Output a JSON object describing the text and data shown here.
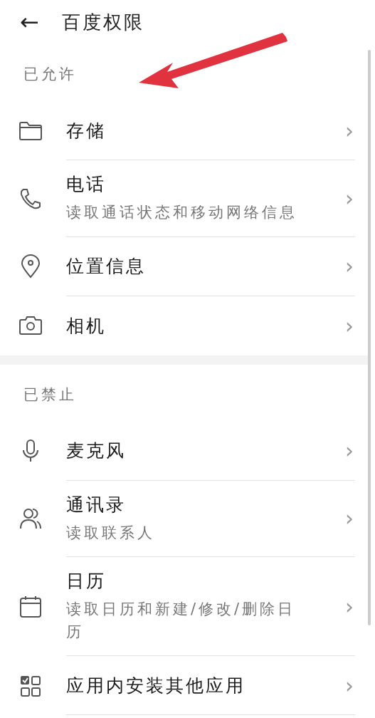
{
  "header": {
    "back": "←",
    "title": "百度权限"
  },
  "sections": [
    {
      "label": "已允许",
      "items": [
        {
          "title": "存储",
          "chevron": "›"
        },
        {
          "title": "电话",
          "subtitle": "读取通话状态和移动网络信息",
          "chevron": "›"
        },
        {
          "title": "位置信息",
          "chevron": "›"
        },
        {
          "title": "相机",
          "chevron": "›"
        }
      ]
    },
    {
      "label": "已禁止",
      "items": [
        {
          "title": "麦克风",
          "chevron": "›"
        },
        {
          "title": "通讯录",
          "subtitle": "读取联系人",
          "chevron": "›"
        },
        {
          "title": "日历",
          "subtitle": "读取日历和新建/修改/删除日历",
          "chevron": "›"
        },
        {
          "title": "应用内安装其他应用",
          "chevron": "›"
        }
      ]
    }
  ]
}
